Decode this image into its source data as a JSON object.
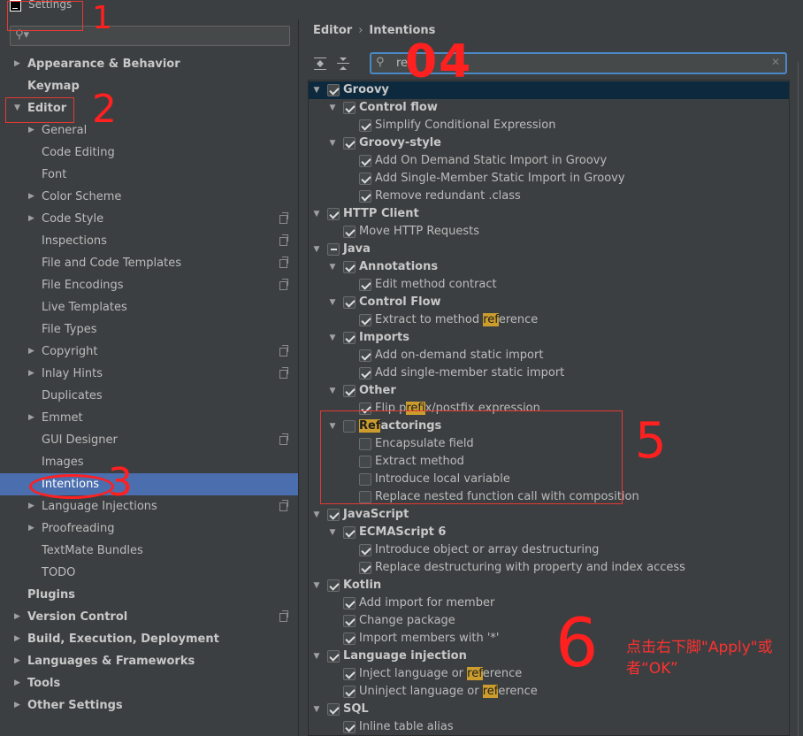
{
  "window": {
    "title": "Settings"
  },
  "left": {
    "search_placeholder": "",
    "items": [
      {
        "label": "Appearance & Behavior",
        "bold": true,
        "arrow": true,
        "indent": 0
      },
      {
        "label": "Keymap",
        "bold": true,
        "arrow": false,
        "indent": 0
      },
      {
        "label": "Editor",
        "bold": true,
        "arrow": "down",
        "indent": 0
      },
      {
        "label": "General",
        "bold": false,
        "arrow": true,
        "indent": 1
      },
      {
        "label": "Code Editing",
        "bold": false,
        "arrow": false,
        "indent": 1
      },
      {
        "label": "Font",
        "bold": false,
        "arrow": false,
        "indent": 1
      },
      {
        "label": "Color Scheme",
        "bold": false,
        "arrow": true,
        "indent": 1
      },
      {
        "label": "Code Style",
        "bold": false,
        "arrow": true,
        "indent": 1,
        "copy": true
      },
      {
        "label": "Inspections",
        "bold": false,
        "arrow": false,
        "indent": 1,
        "copy": true
      },
      {
        "label": "File and Code Templates",
        "bold": false,
        "arrow": false,
        "indent": 1,
        "copy": true
      },
      {
        "label": "File Encodings",
        "bold": false,
        "arrow": false,
        "indent": 1,
        "copy": true
      },
      {
        "label": "Live Templates",
        "bold": false,
        "arrow": false,
        "indent": 1
      },
      {
        "label": "File Types",
        "bold": false,
        "arrow": false,
        "indent": 1
      },
      {
        "label": "Copyright",
        "bold": false,
        "arrow": true,
        "indent": 1,
        "copy": true
      },
      {
        "label": "Inlay Hints",
        "bold": false,
        "arrow": true,
        "indent": 1,
        "copy": true
      },
      {
        "label": "Duplicates",
        "bold": false,
        "arrow": false,
        "indent": 1
      },
      {
        "label": "Emmet",
        "bold": false,
        "arrow": true,
        "indent": 1
      },
      {
        "label": "GUI Designer",
        "bold": false,
        "arrow": false,
        "indent": 1,
        "copy": true
      },
      {
        "label": "Images",
        "bold": false,
        "arrow": false,
        "indent": 1
      },
      {
        "label": "Intentions",
        "bold": false,
        "arrow": false,
        "indent": 1,
        "selected": true
      },
      {
        "label": "Language Injections",
        "bold": false,
        "arrow": true,
        "indent": 1,
        "copy": true
      },
      {
        "label": "Proofreading",
        "bold": false,
        "arrow": true,
        "indent": 1
      },
      {
        "label": "TextMate Bundles",
        "bold": false,
        "arrow": false,
        "indent": 1
      },
      {
        "label": "TODO",
        "bold": false,
        "arrow": false,
        "indent": 1
      },
      {
        "label": "Plugins",
        "bold": true,
        "arrow": false,
        "indent": 0
      },
      {
        "label": "Version Control",
        "bold": true,
        "arrow": true,
        "indent": 0,
        "copy": true
      },
      {
        "label": "Build, Execution, Deployment",
        "bold": true,
        "arrow": true,
        "indent": 0
      },
      {
        "label": "Languages & Frameworks",
        "bold": true,
        "arrow": true,
        "indent": 0
      },
      {
        "label": "Tools",
        "bold": true,
        "arrow": true,
        "indent": 0
      },
      {
        "label": "Other Settings",
        "bold": true,
        "arrow": true,
        "indent": 0
      }
    ]
  },
  "right": {
    "breadcrumb": [
      "Editor",
      "Intentions"
    ],
    "filter_value": "ref",
    "rows": [
      {
        "text": "Groovy",
        "level": 0,
        "group": true,
        "check": "on",
        "hl": true
      },
      {
        "text": "Control flow",
        "level": 1,
        "group": true,
        "check": "on"
      },
      {
        "text": "Simplify Conditional Expression",
        "level": 2,
        "check": "on"
      },
      {
        "text": "Groovy-style",
        "level": 1,
        "group": true,
        "check": "on"
      },
      {
        "text": "Add On Demand Static Import in Groovy",
        "level": 2,
        "check": "on"
      },
      {
        "text": "Add Single-Member Static Import in Groovy",
        "level": 2,
        "check": "on"
      },
      {
        "text": "Remove redundant .class",
        "level": 2,
        "check": "on"
      },
      {
        "text": "HTTP Client",
        "level": 0,
        "group": true,
        "check": "on"
      },
      {
        "text": "Move HTTP Requests",
        "level": 1,
        "check": "on"
      },
      {
        "text": "Java",
        "level": 0,
        "group": true,
        "check": "mixed"
      },
      {
        "text": "Annotations",
        "level": 1,
        "group": true,
        "check": "on"
      },
      {
        "text": "Edit method contract",
        "level": 2,
        "check": "on"
      },
      {
        "text": "Control Flow",
        "level": 1,
        "group": true,
        "check": "on"
      },
      {
        "text": "Extract to method reference",
        "level": 2,
        "check": "on",
        "match": "ref"
      },
      {
        "text": "Imports",
        "level": 1,
        "group": true,
        "check": "on"
      },
      {
        "text": "Add on-demand static import",
        "level": 2,
        "check": "on"
      },
      {
        "text": "Add single-member static import",
        "level": 2,
        "check": "on"
      },
      {
        "text": "Other",
        "level": 1,
        "group": true,
        "check": "on"
      },
      {
        "text": "Flip prefix/postfix expression",
        "level": 2,
        "check": "on",
        "match": "ref"
      },
      {
        "text": "Refactorings",
        "level": 1,
        "group": true,
        "check": "off",
        "match": "Ref"
      },
      {
        "text": "Encapsulate field",
        "level": 2,
        "check": "off"
      },
      {
        "text": "Extract method",
        "level": 2,
        "check": "off"
      },
      {
        "text": "Introduce local variable",
        "level": 2,
        "check": "off"
      },
      {
        "text": "Replace nested function call with composition",
        "level": 2,
        "check": "off"
      },
      {
        "text": "JavaScript",
        "level": 0,
        "group": true,
        "check": "on"
      },
      {
        "text": "ECMAScript 6",
        "level": 1,
        "group": true,
        "check": "on"
      },
      {
        "text": "Introduce object or array destructuring",
        "level": 2,
        "check": "on"
      },
      {
        "text": "Replace destructuring with property and index access",
        "level": 2,
        "check": "on"
      },
      {
        "text": "Kotlin",
        "level": 0,
        "group": true,
        "check": "on"
      },
      {
        "text": "Add import for member",
        "level": 1,
        "check": "on"
      },
      {
        "text": "Change package",
        "level": 1,
        "check": "on"
      },
      {
        "text": "Import members with '*'",
        "level": 1,
        "check": "on"
      },
      {
        "text": "Language injection",
        "level": 0,
        "group": true,
        "check": "on"
      },
      {
        "text": "Inject language or reference",
        "level": 1,
        "check": "on",
        "match": "ref"
      },
      {
        "text": "Uninject language or reference",
        "level": 1,
        "check": "on",
        "match": "ref"
      },
      {
        "text": "SQL",
        "level": 0,
        "group": true,
        "check": "on"
      },
      {
        "text": "Inline table alias",
        "level": 1,
        "check": "on"
      }
    ]
  },
  "annotations": {
    "n1": "1",
    "n2": "2",
    "n3": "3",
    "n4": "04",
    "n5": "5",
    "n6": "6",
    "note": "点击右下脚\"Apply\"或者“OK”"
  },
  "colors": {
    "accent": "#4b6eaf",
    "match": "#cc9d2d",
    "annotation": "#ff2020"
  }
}
